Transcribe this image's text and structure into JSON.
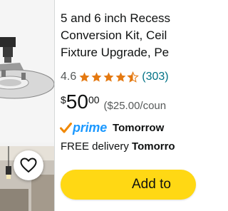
{
  "product": {
    "title_lines": [
      "5 and 6 inch Recess",
      "Conversion Kit, Ceil",
      "Fixture Upgrade, Pe"
    ],
    "rating_value": "4.6",
    "rating_stars": 4.5,
    "review_count": "(303)",
    "price": {
      "currency": "$",
      "whole": "50",
      "fraction": "00",
      "unit_price": "($25.00/coun"
    },
    "prime_label": "prime",
    "delivery_day": "Tomorrow",
    "free_delivery_prefix": "FREE delivery",
    "free_delivery_day": "Tomorro",
    "add_to_cart_label": "Add to"
  },
  "colors": {
    "star": "#e47911",
    "prime_blue": "#1a98ff",
    "button_yellow": "#ffd814",
    "link_teal": "#007185"
  },
  "icons": {
    "wishlist": "heart-outline-icon",
    "prime_check": "check-icon",
    "rating": "star-icon"
  }
}
